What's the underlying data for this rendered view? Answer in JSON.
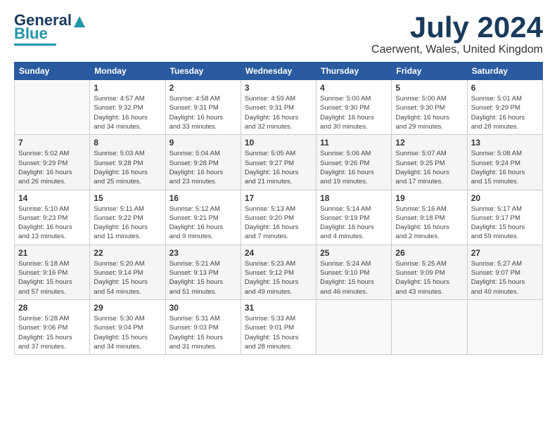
{
  "logo": {
    "line1": "General",
    "line2": "Blue"
  },
  "header": {
    "month": "July 2024",
    "location": "Caerwent, Wales, United Kingdom"
  },
  "weekdays": [
    "Sunday",
    "Monday",
    "Tuesday",
    "Wednesday",
    "Thursday",
    "Friday",
    "Saturday"
  ],
  "weeks": [
    [
      {
        "day": "",
        "info": ""
      },
      {
        "day": "1",
        "info": "Sunrise: 4:57 AM\nSunset: 9:32 PM\nDaylight: 16 hours\nand 34 minutes."
      },
      {
        "day": "2",
        "info": "Sunrise: 4:58 AM\nSunset: 9:31 PM\nDaylight: 16 hours\nand 33 minutes."
      },
      {
        "day": "3",
        "info": "Sunrise: 4:59 AM\nSunset: 9:31 PM\nDaylight: 16 hours\nand 32 minutes."
      },
      {
        "day": "4",
        "info": "Sunrise: 5:00 AM\nSunset: 9:30 PM\nDaylight: 16 hours\nand 30 minutes."
      },
      {
        "day": "5",
        "info": "Sunrise: 5:00 AM\nSunset: 9:30 PM\nDaylight: 16 hours\nand 29 minutes."
      },
      {
        "day": "6",
        "info": "Sunrise: 5:01 AM\nSunset: 9:29 PM\nDaylight: 16 hours\nand 28 minutes."
      }
    ],
    [
      {
        "day": "7",
        "info": "Sunrise: 5:02 AM\nSunset: 9:29 PM\nDaylight: 16 hours\nand 26 minutes."
      },
      {
        "day": "8",
        "info": "Sunrise: 5:03 AM\nSunset: 9:28 PM\nDaylight: 16 hours\nand 25 minutes."
      },
      {
        "day": "9",
        "info": "Sunrise: 5:04 AM\nSunset: 9:28 PM\nDaylight: 16 hours\nand 23 minutes."
      },
      {
        "day": "10",
        "info": "Sunrise: 5:05 AM\nSunset: 9:27 PM\nDaylight: 16 hours\nand 21 minutes."
      },
      {
        "day": "11",
        "info": "Sunrise: 5:06 AM\nSunset: 9:26 PM\nDaylight: 16 hours\nand 19 minutes."
      },
      {
        "day": "12",
        "info": "Sunrise: 5:07 AM\nSunset: 9:25 PM\nDaylight: 16 hours\nand 17 minutes."
      },
      {
        "day": "13",
        "info": "Sunrise: 5:08 AM\nSunset: 9:24 PM\nDaylight: 16 hours\nand 15 minutes."
      }
    ],
    [
      {
        "day": "14",
        "info": "Sunrise: 5:10 AM\nSunset: 9:23 PM\nDaylight: 16 hours\nand 13 minutes."
      },
      {
        "day": "15",
        "info": "Sunrise: 5:11 AM\nSunset: 9:22 PM\nDaylight: 16 hours\nand 11 minutes."
      },
      {
        "day": "16",
        "info": "Sunrise: 5:12 AM\nSunset: 9:21 PM\nDaylight: 16 hours\nand 9 minutes."
      },
      {
        "day": "17",
        "info": "Sunrise: 5:13 AM\nSunset: 9:20 PM\nDaylight: 16 hours\nand 7 minutes."
      },
      {
        "day": "18",
        "info": "Sunrise: 5:14 AM\nSunset: 9:19 PM\nDaylight: 16 hours\nand 4 minutes."
      },
      {
        "day": "19",
        "info": "Sunrise: 5:16 AM\nSunset: 9:18 PM\nDaylight: 16 hours\nand 2 minutes."
      },
      {
        "day": "20",
        "info": "Sunrise: 5:17 AM\nSunset: 9:17 PM\nDaylight: 15 hours\nand 59 minutes."
      }
    ],
    [
      {
        "day": "21",
        "info": "Sunrise: 5:18 AM\nSunset: 9:16 PM\nDaylight: 15 hours\nand 57 minutes."
      },
      {
        "day": "22",
        "info": "Sunrise: 5:20 AM\nSunset: 9:14 PM\nDaylight: 15 hours\nand 54 minutes."
      },
      {
        "day": "23",
        "info": "Sunrise: 5:21 AM\nSunset: 9:13 PM\nDaylight: 15 hours\nand 51 minutes."
      },
      {
        "day": "24",
        "info": "Sunrise: 5:23 AM\nSunset: 9:12 PM\nDaylight: 15 hours\nand 49 minutes."
      },
      {
        "day": "25",
        "info": "Sunrise: 5:24 AM\nSunset: 9:10 PM\nDaylight: 15 hours\nand 46 minutes."
      },
      {
        "day": "26",
        "info": "Sunrise: 5:25 AM\nSunset: 9:09 PM\nDaylight: 15 hours\nand 43 minutes."
      },
      {
        "day": "27",
        "info": "Sunrise: 5:27 AM\nSunset: 9:07 PM\nDaylight: 15 hours\nand 40 minutes."
      }
    ],
    [
      {
        "day": "28",
        "info": "Sunrise: 5:28 AM\nSunset: 9:06 PM\nDaylight: 15 hours\nand 37 minutes."
      },
      {
        "day": "29",
        "info": "Sunrise: 5:30 AM\nSunset: 9:04 PM\nDaylight: 15 hours\nand 34 minutes."
      },
      {
        "day": "30",
        "info": "Sunrise: 5:31 AM\nSunset: 9:03 PM\nDaylight: 15 hours\nand 31 minutes."
      },
      {
        "day": "31",
        "info": "Sunrise: 5:33 AM\nSunset: 9:01 PM\nDaylight: 15 hours\nand 28 minutes."
      },
      {
        "day": "",
        "info": ""
      },
      {
        "day": "",
        "info": ""
      },
      {
        "day": "",
        "info": ""
      }
    ]
  ]
}
